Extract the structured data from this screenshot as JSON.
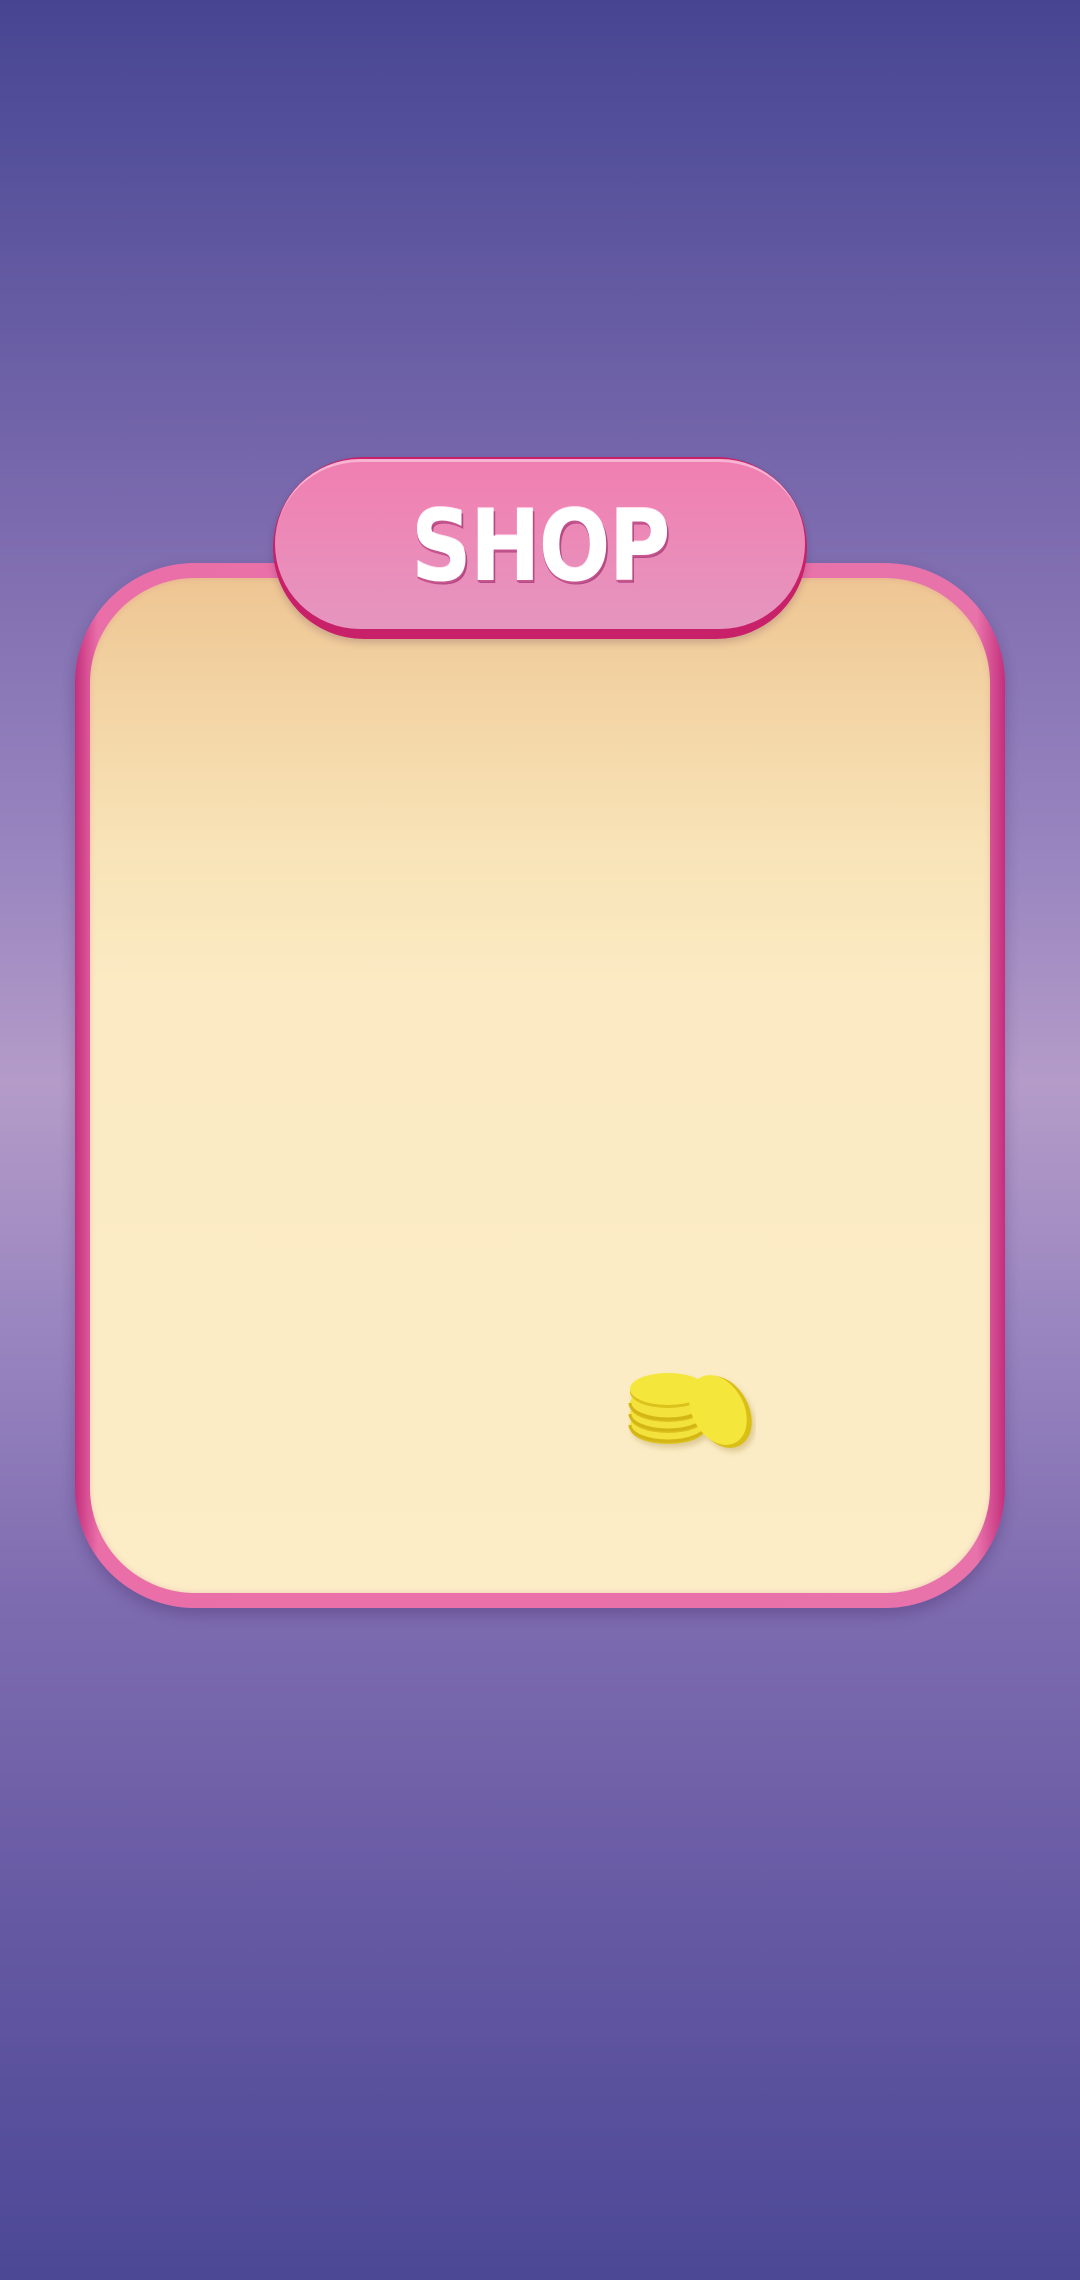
{
  "shop": {
    "title": "SHOP"
  },
  "icons": {
    "coins": "coin-stack-icon"
  },
  "colors": {
    "background_top": "#474592",
    "background_middle": "#b49bc8",
    "panel_border": "#e872aa",
    "panel_fill": "#fcedc7",
    "title_tab": "#ec89b7",
    "coin": "#f6e636"
  }
}
